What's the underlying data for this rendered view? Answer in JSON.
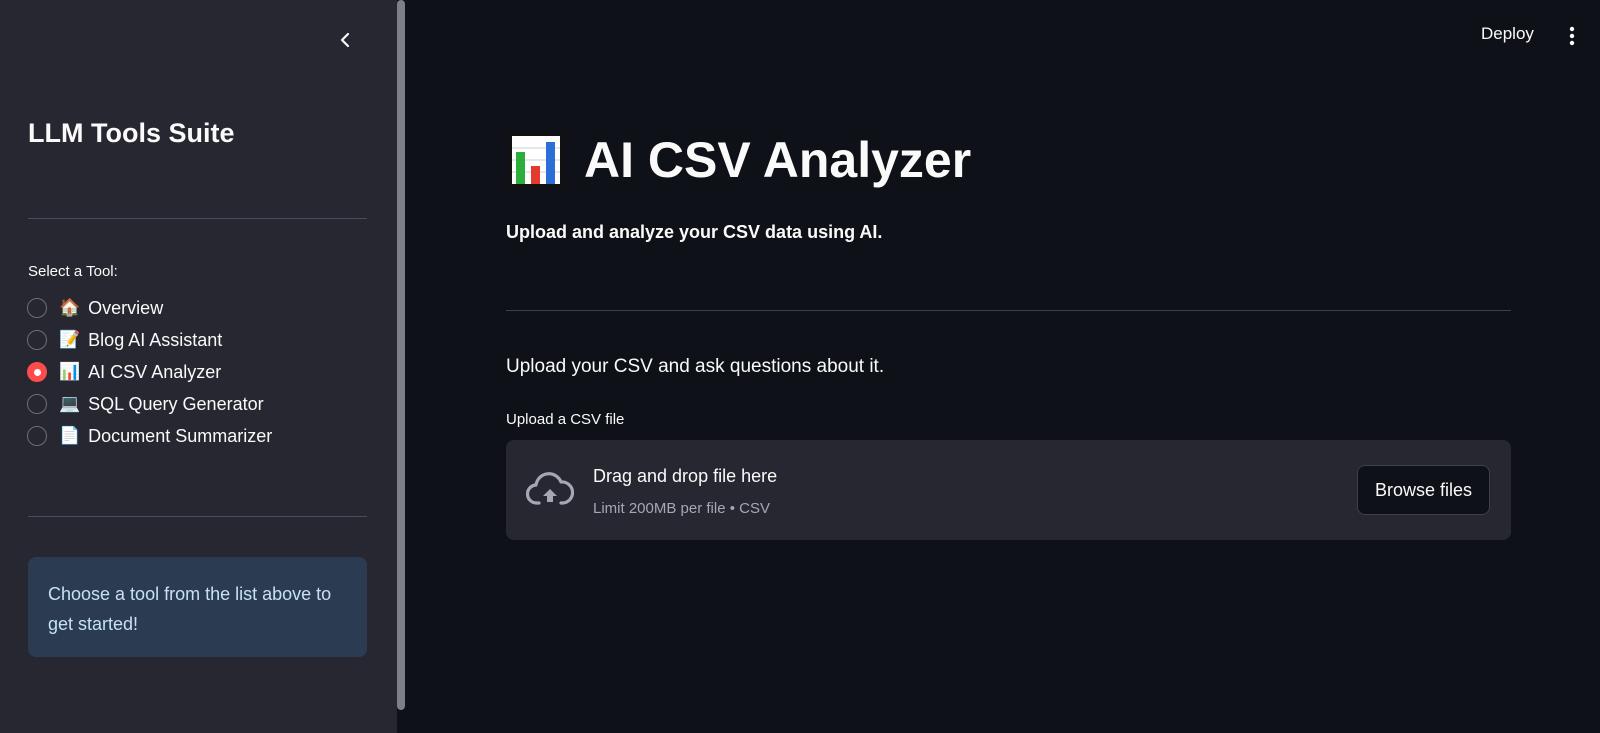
{
  "header": {
    "deploy_label": "Deploy",
    "menu_icon": "more-vertical-icon"
  },
  "sidebar": {
    "collapse_icon": "chevron-left-icon",
    "title": "LLM Tools Suite",
    "radio_label": "Select a Tool:",
    "items": [
      {
        "emoji": "🏠",
        "label": "Overview",
        "selected": false
      },
      {
        "emoji": "📝",
        "label": "Blog AI Assistant",
        "selected": false
      },
      {
        "emoji": "📊",
        "label": "AI CSV Analyzer",
        "selected": true
      },
      {
        "emoji": "💻",
        "label": "SQL Query Generator",
        "selected": false
      },
      {
        "emoji": "📄",
        "label": "Document Summarizer",
        "selected": false
      }
    ],
    "info_text": "Choose a tool from the list above to get started!"
  },
  "main": {
    "title_icon": "bar-chart-icon",
    "title": "AI CSV Analyzer",
    "subtitle": "Upload and analyze your CSV data using AI.",
    "description": "Upload your CSV and ask questions about it.",
    "uploader": {
      "label": "Upload a CSV file",
      "icon": "cloud-upload-icon",
      "drag_text": "Drag and drop file here",
      "limit_text": "Limit 200MB per file • CSV",
      "browse_label": "Browse files"
    }
  },
  "colors": {
    "background": "#0e1117",
    "sidebar": "#262730",
    "accent": "#ff4b4b",
    "info_bg": "#2b3c52",
    "info_text": "#c7e0f4"
  }
}
